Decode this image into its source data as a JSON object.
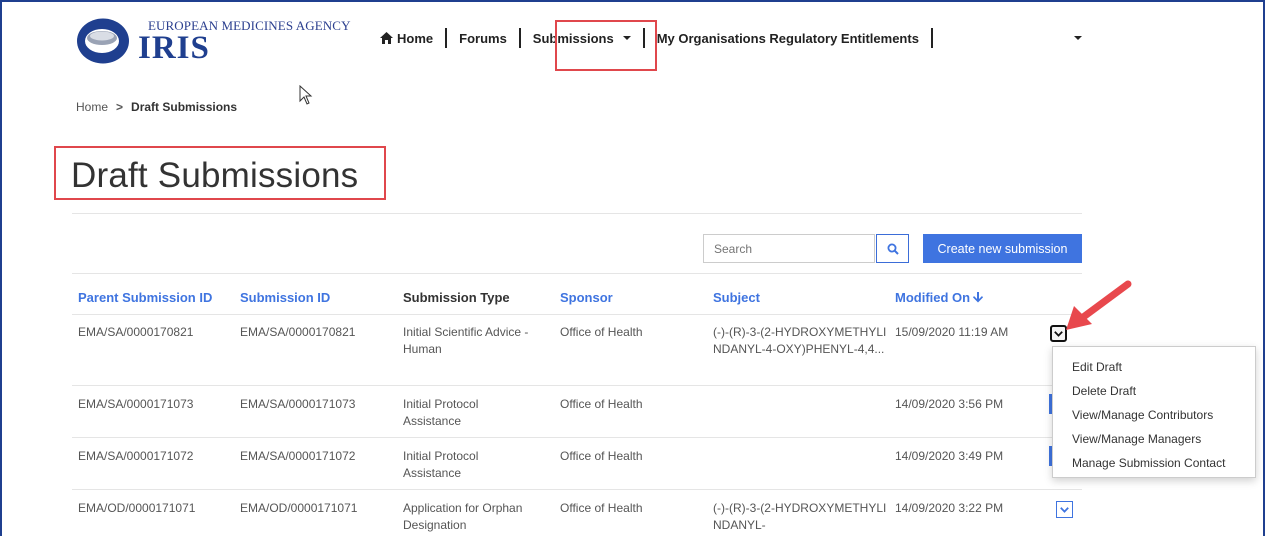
{
  "header": {
    "agency_name": "EUROPEAN MEDICINES AGENCY",
    "app_name": "IRIS",
    "nav": [
      {
        "label": "Home",
        "icon": "home-icon"
      },
      {
        "label": "Forums"
      },
      {
        "label": "Submissions",
        "has_dropdown": true
      },
      {
        "label": "My Organisations Regulatory Entitlements"
      }
    ]
  },
  "breadcrumb": {
    "home": "Home",
    "separator": ">",
    "current": "Draft Submissions"
  },
  "page_title": "Draft Submissions",
  "toolbar": {
    "search_placeholder": "Search",
    "search_icon": "search-icon",
    "create_label": "Create new submission"
  },
  "table": {
    "columns": [
      "Parent Submission ID",
      "Submission ID",
      "Submission Type",
      "Sponsor",
      "Subject",
      "Modified On"
    ],
    "rows": [
      {
        "parent_id": "EMA/SA/0000170821",
        "submission_id": "EMA/SA/0000170821",
        "type": "Initial Scientific Advice - Human",
        "sponsor": "Office of Health",
        "subject": "(-)-(R)-3-(2-HYDROXYMETHYLINDANYL-4-OXY)PHENYL-4,4...",
        "modified": "15/09/2020 11:19 AM"
      },
      {
        "parent_id": "EMA/SA/0000171073",
        "submission_id": "EMA/SA/0000171073",
        "type": "Initial Protocol Assistance",
        "sponsor": "Office of Health",
        "subject": "",
        "modified": "14/09/2020 3:56 PM"
      },
      {
        "parent_id": "EMA/SA/0000171072",
        "submission_id": "EMA/SA/0000171072",
        "type": "Initial Protocol Assistance",
        "sponsor": "Office of Health",
        "subject": "",
        "modified": "14/09/2020 3:49 PM"
      },
      {
        "parent_id": "EMA/OD/0000171071",
        "submission_id": "EMA/OD/0000171071",
        "type": "Application for Orphan Designation",
        "sponsor": "Office of Health",
        "subject": "(-)-(R)-3-(2-HYDROXYMETHYLINDANYL-",
        "modified": "14/09/2020 3:22 PM"
      }
    ]
  },
  "action_menu": {
    "items": [
      "Edit Draft",
      "Delete Draft",
      "View/Manage Contributors",
      "View/Manage Managers",
      "Manage Submission Contact"
    ]
  },
  "colors": {
    "brand": "#1f3f8f",
    "link": "#3f74e0",
    "highlight": "#e0474c"
  }
}
